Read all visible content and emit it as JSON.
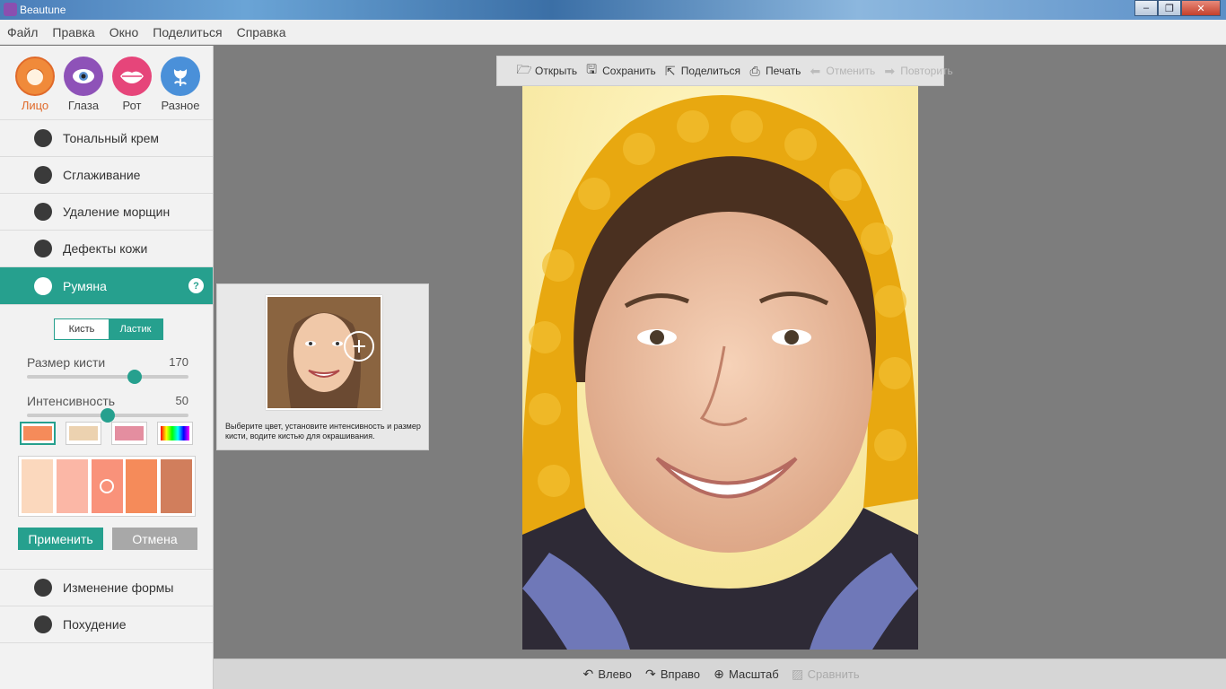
{
  "window": {
    "title": "Beautune",
    "controls": [
      "–",
      "❐",
      "✕"
    ]
  },
  "menu": [
    "Файл",
    "Правка",
    "Окно",
    "Поделиться",
    "Справка"
  ],
  "categories": [
    {
      "label": "Лицо",
      "icon": "face-icon",
      "color": "#f08a3a",
      "active": true
    },
    {
      "label": "Глаза",
      "icon": "eye-icon",
      "color": "#8e52b8"
    },
    {
      "label": "Рот",
      "icon": "lips-icon",
      "color": "#e6457a"
    },
    {
      "label": "Разное",
      "icon": "flower-icon",
      "color": "#4a90d9"
    }
  ],
  "tools_top": [
    {
      "label": "Тональный крем",
      "icon": "foundation-icon"
    },
    {
      "label": "Сглаживание",
      "icon": "smoothing-icon"
    },
    {
      "label": "Удаление морщин",
      "icon": "wrinkles-icon"
    },
    {
      "label": "Дефекты кожи",
      "icon": "skin-defects-icon"
    }
  ],
  "active_tool": {
    "label": "Румяна",
    "icon": "blush-icon",
    "help": "?"
  },
  "blush_panel": {
    "mode_brush": "Кисть",
    "mode_eraser": "Ластик",
    "brush_size_label": "Размер кисти",
    "brush_size_value": "170",
    "brush_size_fraction": 0.68,
    "intensity_label": "Интенсивность",
    "intensity_value": "50",
    "intensity_fraction": 0.5,
    "palettes": [
      "#f58b5a",
      "#ecd2b0",
      "#e48ea0",
      "rainbow"
    ],
    "shades": [
      "#fbd8bd",
      "#fbb7a6",
      "#f9927a",
      "#f58b5a",
      "#d17e5c"
    ],
    "selected_shade": 2,
    "apply": "Применить",
    "cancel": "Отмена"
  },
  "tools_bottom": [
    {
      "label": "Изменение формы",
      "icon": "reshape-icon"
    },
    {
      "label": "Похудение",
      "icon": "slimming-icon"
    }
  ],
  "tooltip": {
    "text": "Выберите цвет, установите интенсивность и размер кисти, водите кистью для окрашивания.",
    "plus": "+"
  },
  "toolbar": {
    "open": "Открыть",
    "save": "Сохранить",
    "share": "Поделиться",
    "print": "Печать",
    "undo": "Отменить",
    "redo": "Повторить"
  },
  "bottombar": {
    "left": "Влево",
    "right": "Вправо",
    "zoom": "Масштаб",
    "compare": "Сравнить"
  },
  "colors": {
    "accent": "#26a08e",
    "canvas_bg": "#7d7d7d"
  }
}
